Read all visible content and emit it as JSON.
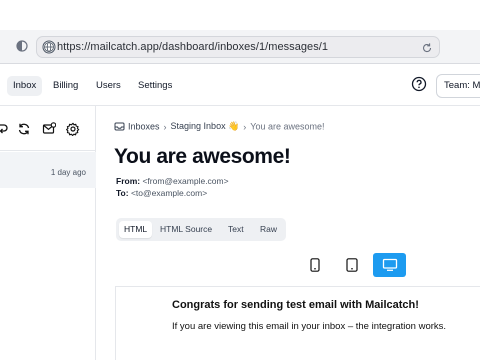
{
  "browser": {
    "url": "https://mailcatch.app/dashboard/inboxes/1/messages/1"
  },
  "nav": {
    "items": [
      {
        "label": "Inbox",
        "active": true
      },
      {
        "label": "Billing",
        "active": false
      },
      {
        "label": "Users",
        "active": false
      },
      {
        "label": "Settings",
        "active": false
      }
    ],
    "team_label": "Team: Ma"
  },
  "message_list": {
    "items": [
      {
        "time": "1 day ago"
      }
    ]
  },
  "breadcrumb": {
    "inboxes": "Inboxes",
    "inbox": "Staging Inbox 👋",
    "current": "You are awesome!"
  },
  "message": {
    "subject": "You are awesome!",
    "from_label": "From:",
    "from_value": "<from@example.com>",
    "to_label": "To:",
    "to_value": "<to@example.com>"
  },
  "view_tabs": [
    {
      "label": "HTML",
      "active": true
    },
    {
      "label": "HTML Source",
      "active": false
    },
    {
      "label": "Text",
      "active": false
    },
    {
      "label": "Raw",
      "active": false
    }
  ],
  "device_modes": [
    {
      "icon": "phone-icon",
      "active": false
    },
    {
      "icon": "tablet-icon",
      "active": false
    },
    {
      "icon": "desktop-icon",
      "active": true
    }
  ],
  "preview": {
    "heading": "Congrats for sending test email with Mailcatch!",
    "body": "If you are viewing this email in your inbox – the integration works."
  },
  "colors": {
    "accent": "#1d9bf0",
    "active_nav_bg": "#eef0f3"
  }
}
